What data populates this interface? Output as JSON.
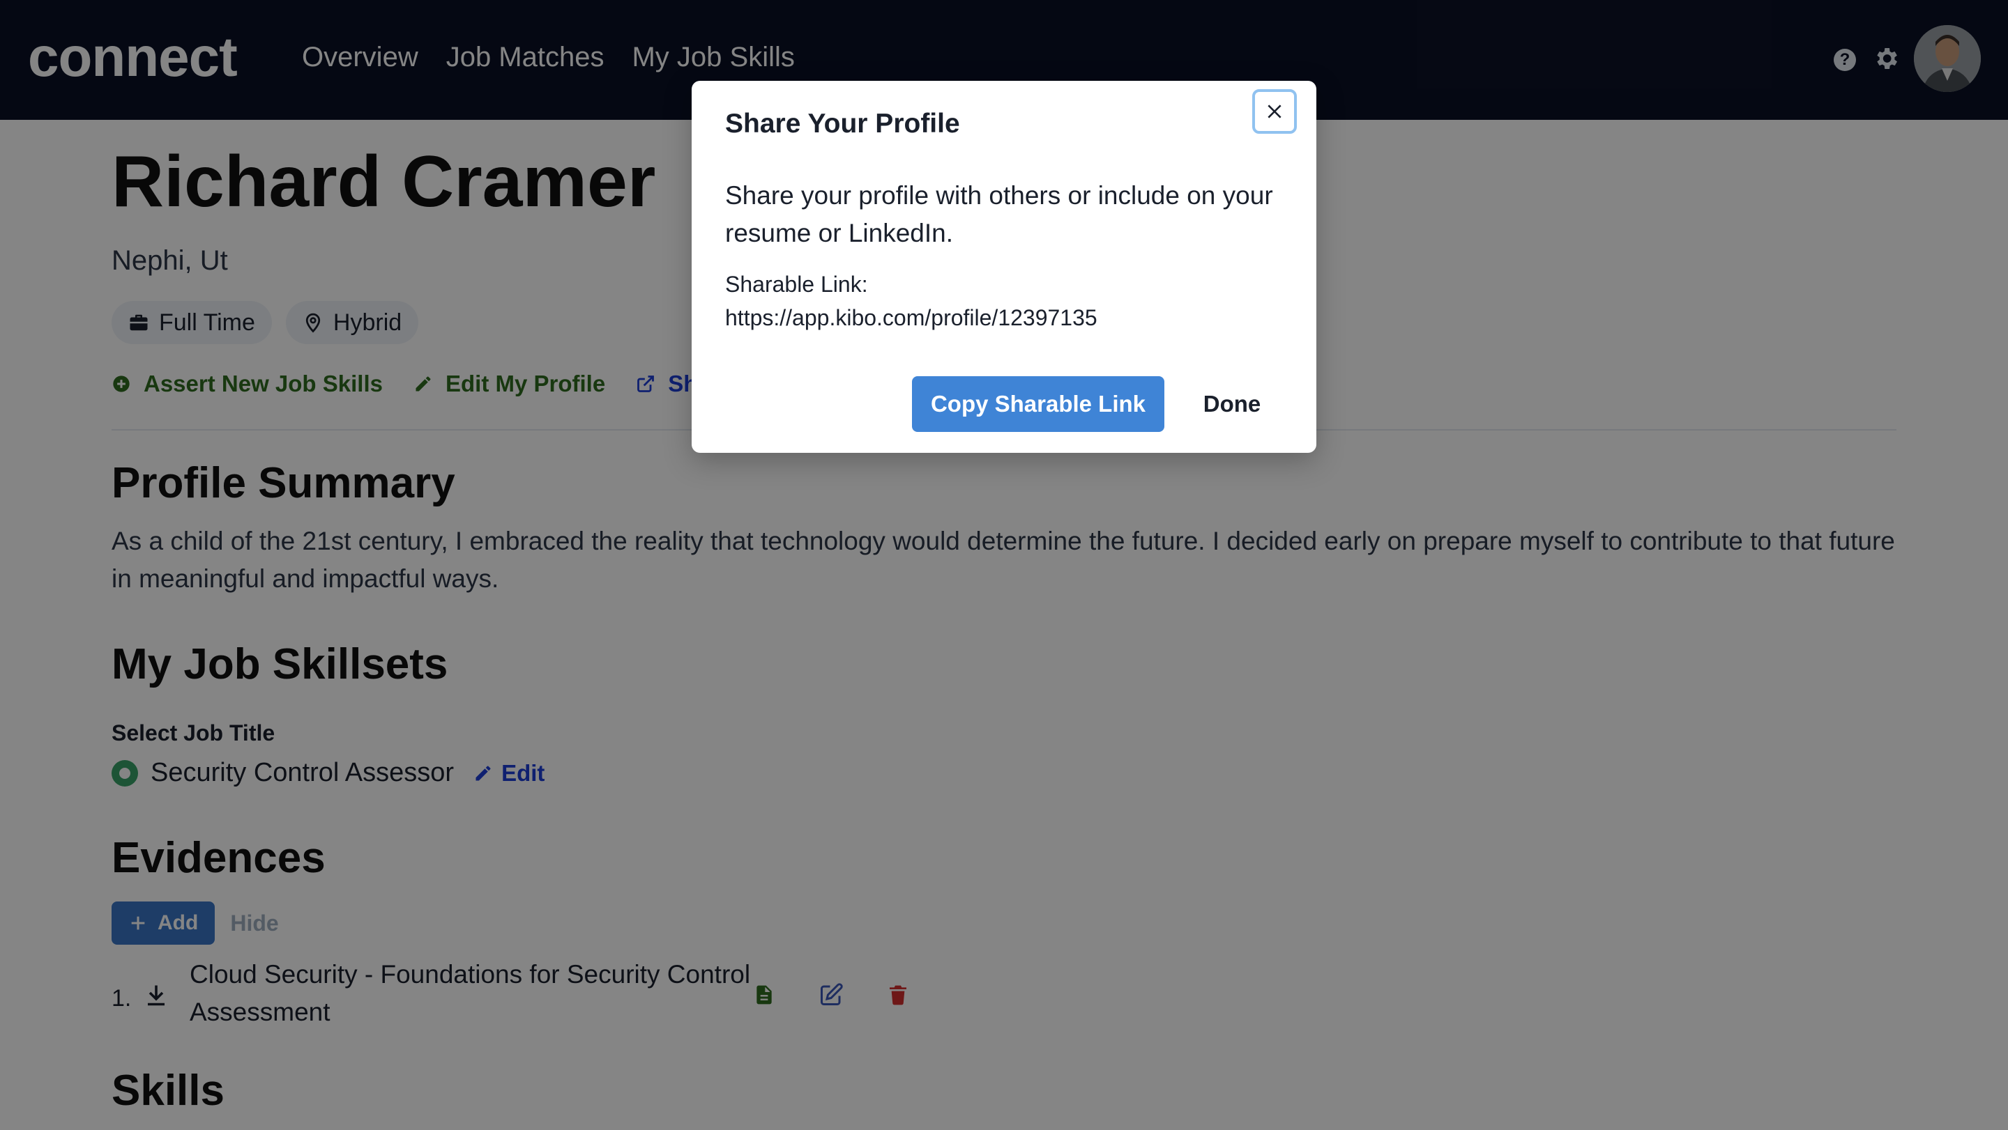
{
  "app": {
    "logo": "connect"
  },
  "nav": {
    "items": [
      "Overview",
      "Job Matches",
      "My Job Skills"
    ]
  },
  "header_icons": {
    "help": "help-icon",
    "settings": "gear-icon",
    "profile": "avatar"
  },
  "profile": {
    "name": "Richard Cramer",
    "location": "Nephi, Ut",
    "chips": [
      {
        "icon": "briefcase-icon",
        "label": "Full Time"
      },
      {
        "icon": "location-pin-icon",
        "label": "Hybrid"
      }
    ],
    "actions": [
      {
        "icon": "plus-circle-icon",
        "label": "Assert New Job Skills",
        "color": "#2f6b1f"
      },
      {
        "icon": "pencil-icon",
        "label": "Edit My Profile",
        "color": "#2f6b1f"
      },
      {
        "icon": "external-link-icon",
        "label": "Sha",
        "color": "#1e3fd6"
      }
    ]
  },
  "summary": {
    "heading": "Profile Summary",
    "text": "As a child of the 21st century, I embraced the reality that technology would determine the future. I decided early on prepare myself to contribute to that future in meaningful and impactful ways."
  },
  "skillsets": {
    "heading": "My Job Skillsets",
    "select_label": "Select Job Title",
    "selected_title": "Security Control Assessor",
    "edit_label": "Edit"
  },
  "evidences": {
    "heading": "Evidences",
    "add_label": "Add",
    "hide_label": "Hide",
    "items": [
      {
        "number": "1.",
        "title": "Cloud Security - Foundations for Security Control Assessment"
      }
    ]
  },
  "skills": {
    "heading": "Skills"
  },
  "modal": {
    "title": "Share Your Profile",
    "body": "Share your profile with others or include on your resume or LinkedIn.",
    "link_label": "Sharable Link:",
    "link_url": "https://app.kibo.com/profile/12397135",
    "copy_label": "Copy Sharable Link",
    "done_label": "Done"
  },
  "colors": {
    "topbar": "#0b1126",
    "green_action": "#2f6b1f",
    "blue_link": "#1e3fd6",
    "primary_button": "#3f84d6",
    "delete_red": "#d32f2f",
    "radio_green": "#38a169"
  }
}
